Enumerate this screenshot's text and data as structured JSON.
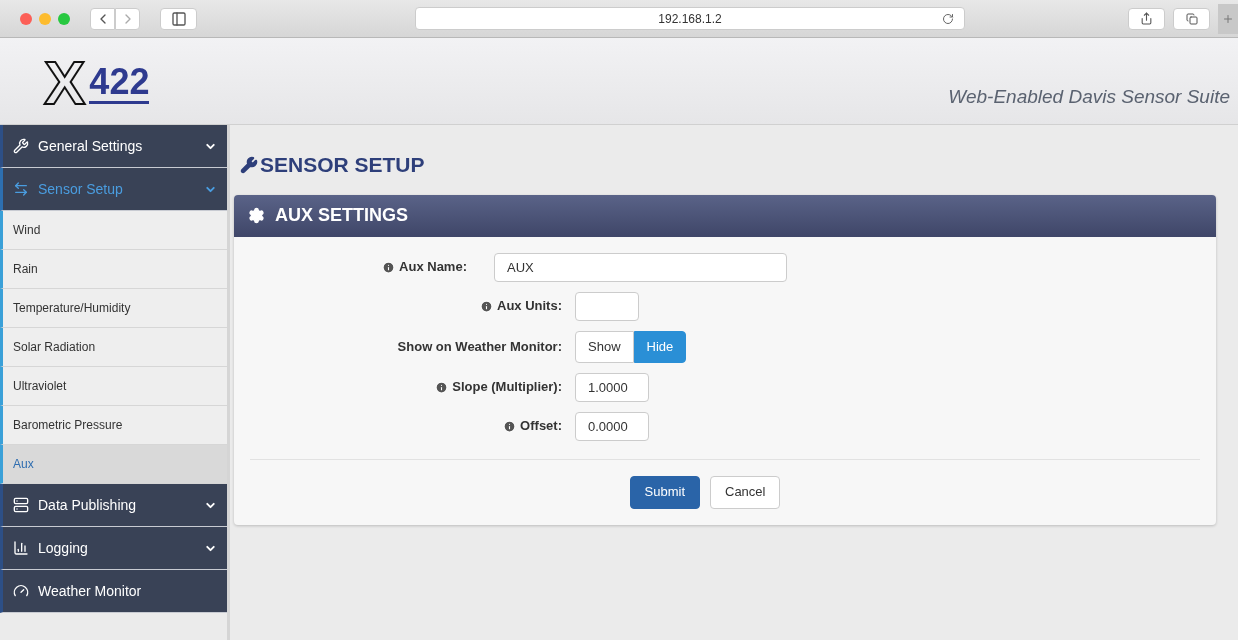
{
  "browser": {
    "url": "192.168.1.2"
  },
  "header": {
    "logo": {
      "letter": "X",
      "number": "422"
    },
    "tagline": "Web-Enabled Davis Sensor Suite"
  },
  "sidebar": {
    "items": [
      {
        "label": "General Settings",
        "selected": false,
        "expandable": true
      },
      {
        "label": "Sensor Setup",
        "selected": true,
        "expandable": true,
        "expanded": true,
        "children": [
          {
            "label": "Wind",
            "selected": false
          },
          {
            "label": "Rain",
            "selected": false
          },
          {
            "label": "Temperature/Humidity",
            "selected": false
          },
          {
            "label": "Solar Radiation",
            "selected": false
          },
          {
            "label": "Ultraviolet",
            "selected": false
          },
          {
            "label": "Barometric Pressure",
            "selected": false
          },
          {
            "label": "Aux",
            "selected": true
          }
        ]
      },
      {
        "label": "Data Publishing",
        "selected": false,
        "expandable": true
      },
      {
        "label": "Logging",
        "selected": false,
        "expandable": true
      },
      {
        "label": "Weather Monitor",
        "selected": false,
        "expandable": false
      }
    ]
  },
  "page": {
    "title": "SENSOR SETUP",
    "panel": {
      "title": "AUX SETTINGS",
      "fields": [
        {
          "kind": "text",
          "label": "Aux Name:",
          "info": true,
          "value": "AUX"
        },
        {
          "kind": "text",
          "label": "Aux Units:",
          "info": true
        },
        {
          "kind": "toggle",
          "label": "Show on Weather Monitor:",
          "info": false,
          "options": [
            {
              "label": "Show",
              "selected": false
            },
            {
              "label": "Hide",
              "selected": true
            }
          ]
        },
        {
          "kind": "text",
          "label": "Slope (Multiplier):",
          "info": true,
          "value": "1.0000"
        },
        {
          "kind": "text",
          "label": "Offset:",
          "info": true,
          "value": "0.0000"
        }
      ],
      "buttons": [
        {
          "label": "Submit",
          "kind": "primary"
        },
        {
          "label": "Cancel",
          "kind": "default"
        }
      ]
    }
  }
}
